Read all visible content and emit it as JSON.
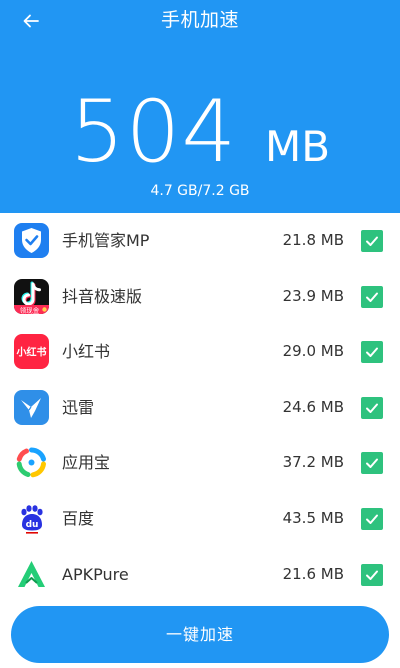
{
  "header": {
    "title": "手机加速",
    "back_icon": "back-arrow-icon"
  },
  "summary": {
    "freeable_value": "504",
    "freeable_unit": "MB",
    "memory_usage": "4.7 GB/7.2 GB"
  },
  "apps": [
    {
      "name": "手机管家MP",
      "size": "21.8 MB",
      "checked": true,
      "icon": "phone-manager-icon"
    },
    {
      "name": "抖音极速版",
      "size": "23.9 MB",
      "checked": true,
      "icon": "douyin-icon",
      "icon_badge": "领现金"
    },
    {
      "name": "小红书",
      "size": "29.0 MB",
      "checked": true,
      "icon": "xiaohongshu-icon",
      "icon_text": "小红书"
    },
    {
      "name": "迅雷",
      "size": "24.6 MB",
      "checked": true,
      "icon": "xunlei-icon"
    },
    {
      "name": "应用宝",
      "size": "37.2 MB",
      "checked": true,
      "icon": "yingyongbao-icon"
    },
    {
      "name": "百度",
      "size": "43.5 MB",
      "checked": true,
      "icon": "baidu-icon",
      "icon_text": "du"
    },
    {
      "name": "APKPure",
      "size": "21.6 MB",
      "checked": true,
      "icon": "apkpure-icon"
    }
  ],
  "actions": {
    "boost_label": "一键加速"
  },
  "colors": {
    "primary": "#2196f3",
    "check": "#2ec27e"
  }
}
